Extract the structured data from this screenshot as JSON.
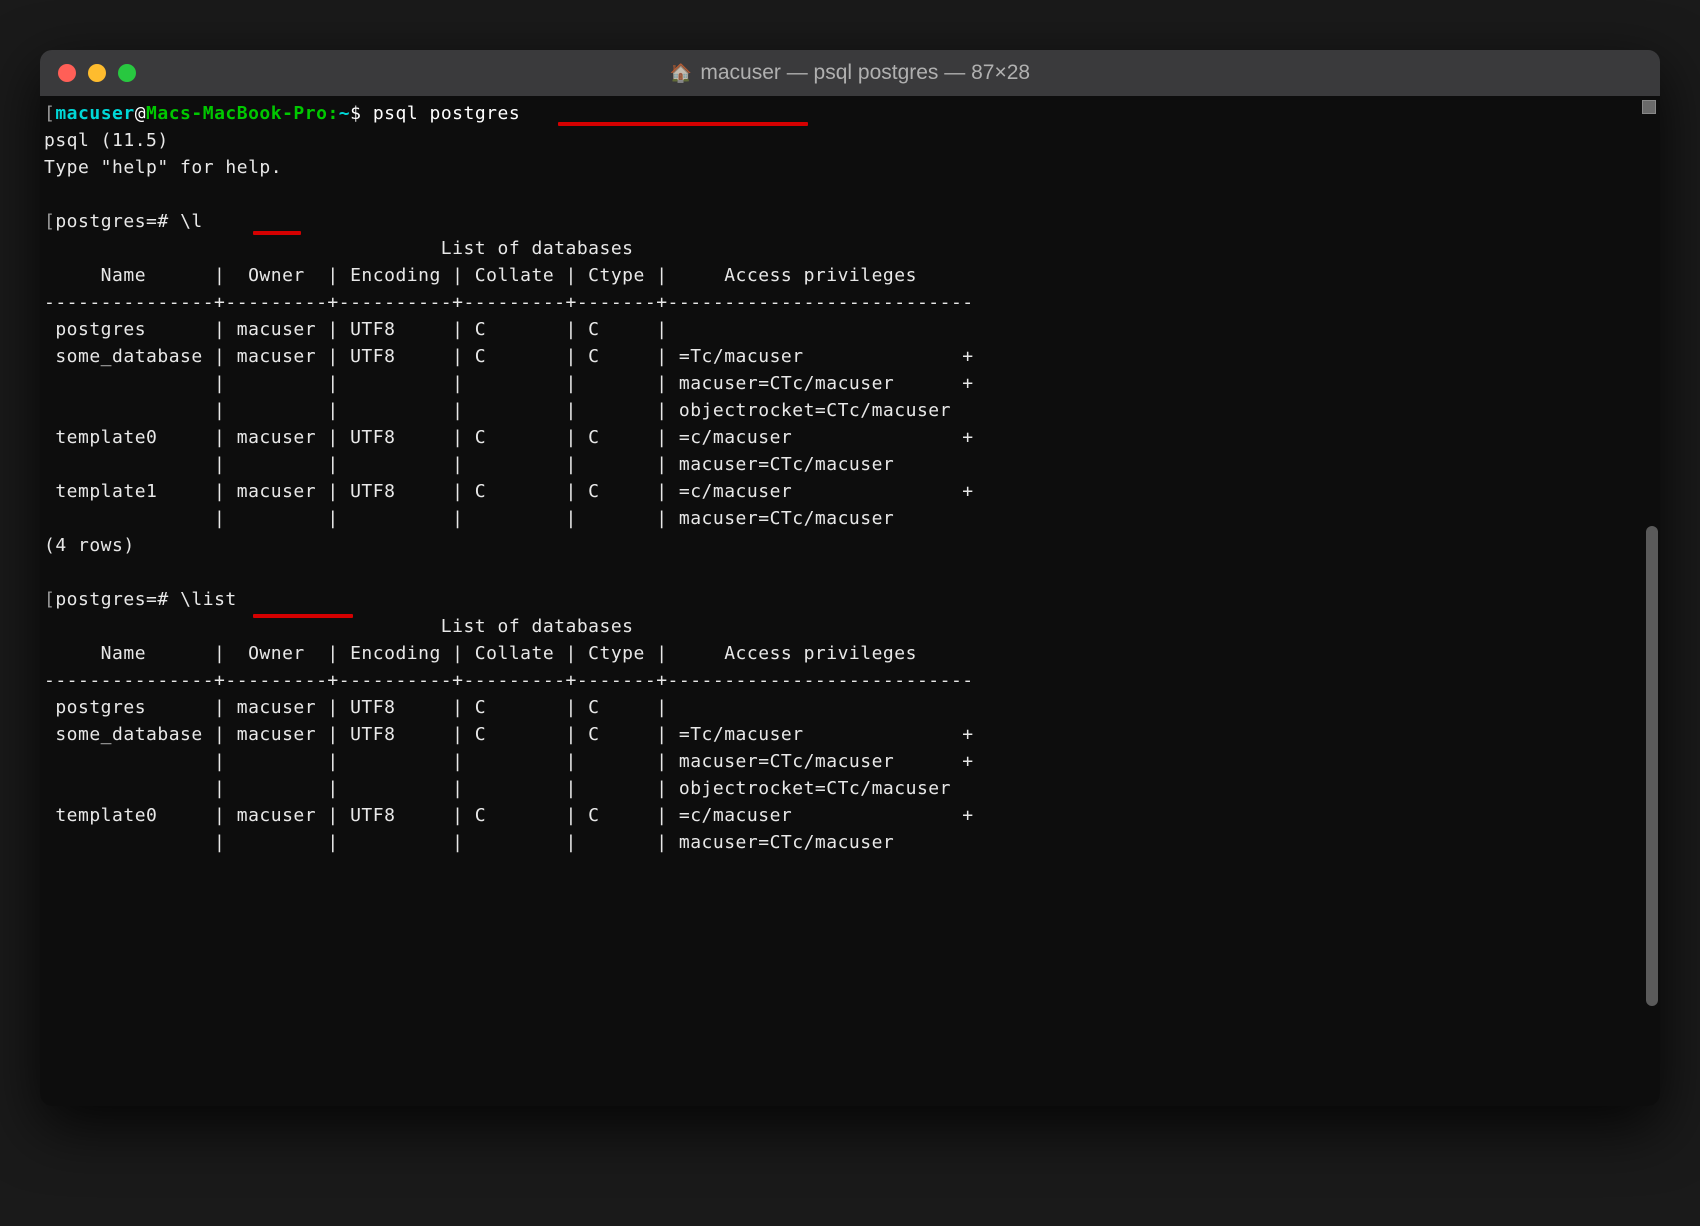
{
  "window": {
    "title": "macuser — psql postgres — 87×28"
  },
  "prompt": {
    "user": "macuser",
    "at": "@",
    "host": "Macs-MacBook-Pro",
    "sep": ":",
    "path": "~",
    "symbol": "$",
    "command": "psql postgres"
  },
  "psql": {
    "version_line": "psql (11.5)",
    "help_line": "Type \"help\" for help."
  },
  "psql_prompt1": {
    "prefix": "postgres=#",
    "command": "\\l"
  },
  "table1": {
    "title": "                                   List of databases",
    "header": "     Name      |  Owner  | Encoding | Collate | Ctype |     Access privileges     ",
    "divider": "---------------+---------+----------+---------+-------+---------------------------",
    "rows": [
      " postgres      | macuser | UTF8     | C       | C     | ",
      " some_database | macuser | UTF8     | C       | C     | =Tc/macuser              +",
      "               |         |          |         |       | macuser=CTc/macuser      +",
      "               |         |          |         |       | objectrocket=CTc/macuser",
      " template0     | macuser | UTF8     | C       | C     | =c/macuser               +",
      "               |         |          |         |       | macuser=CTc/macuser",
      " template1     | macuser | UTF8     | C       | C     | =c/macuser               +",
      "               |         |          |         |       | macuser=CTc/macuser"
    ],
    "footer": "(4 rows)"
  },
  "psql_prompt2": {
    "prefix": "postgres=#",
    "command": "\\list"
  },
  "table2": {
    "title": "                                   List of databases",
    "header": "     Name      |  Owner  | Encoding | Collate | Ctype |     Access privileges     ",
    "divider": "---------------+---------+----------+---------+-------+---------------------------",
    "rows": [
      " postgres      | macuser | UTF8     | C       | C     | ",
      " some_database | macuser | UTF8     | C       | C     | =Tc/macuser              +",
      "               |         |          |         |       | macuser=CTc/macuser      +",
      "               |         |          |         |       | objectrocket=CTc/macuser",
      " template0     | macuser | UTF8     | C       | C     | =c/macuser               +",
      "               |         |          |         |       | macuser=CTc/macuser"
    ]
  }
}
